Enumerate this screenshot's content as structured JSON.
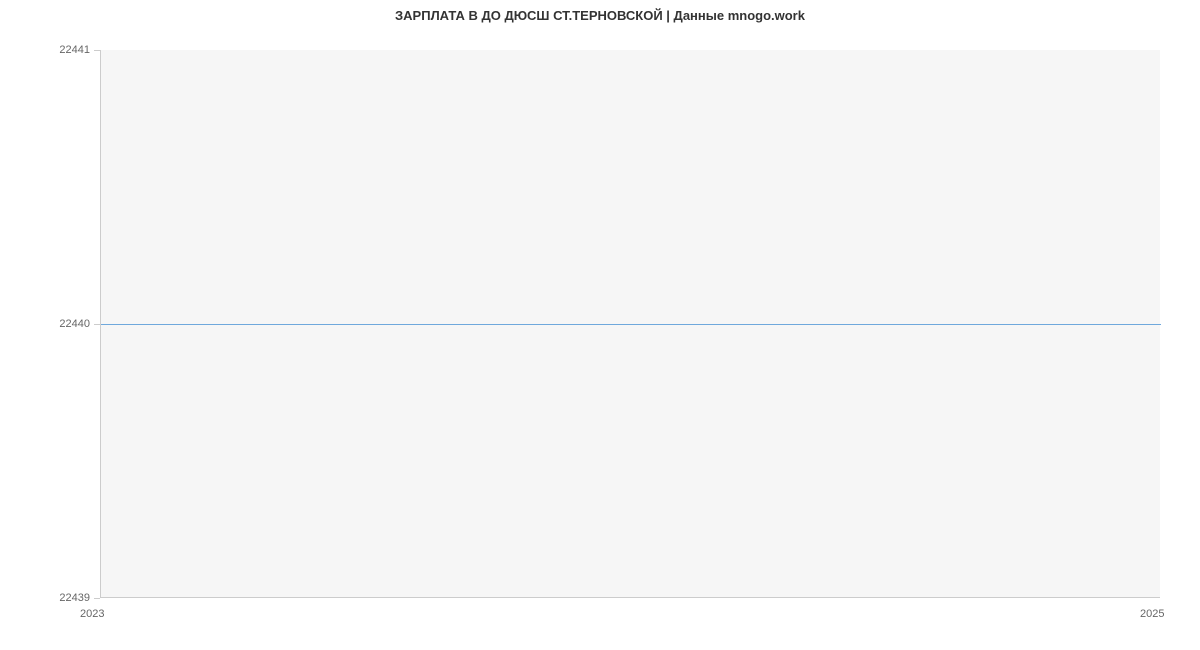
{
  "chart_data": {
    "type": "line",
    "title": "ЗАРПЛАТА В ДО ДЮСШ СТ.ТЕРНОВСКОЙ | Данные mnogo.work",
    "x": [
      2023,
      2025
    ],
    "values": [
      22440,
      22440
    ],
    "xlim": [
      2023,
      2025
    ],
    "ylim": [
      22439,
      22441
    ],
    "x_ticks": [
      2023,
      2025
    ],
    "y_ticks": [
      22439,
      22440,
      22441
    ],
    "xlabel": "",
    "ylabel": "",
    "line_color": "#6fa8dc",
    "grid": false
  }
}
